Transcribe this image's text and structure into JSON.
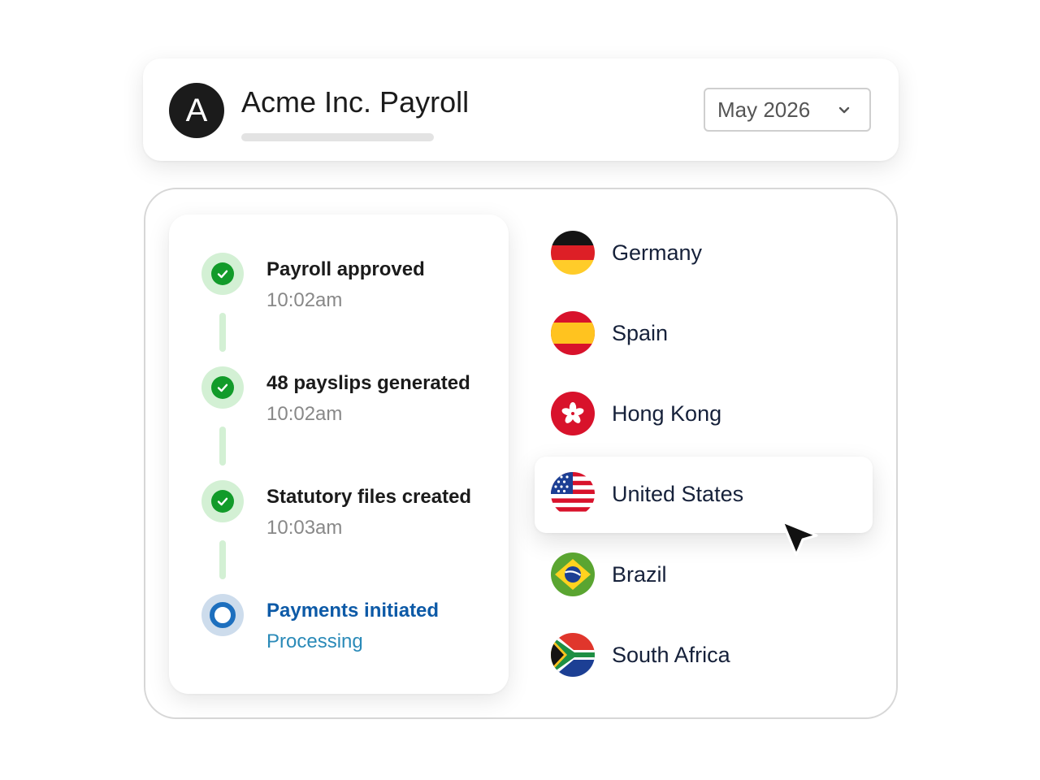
{
  "header": {
    "avatar_letter": "A",
    "title": "Acme Inc. Payroll",
    "month_select": {
      "value": "May 2026"
    }
  },
  "timeline": {
    "steps": [
      {
        "title": "Payroll approved",
        "time": "10:02am",
        "status": "done"
      },
      {
        "title": "48 payslips generated",
        "time": "10:02am",
        "status": "done"
      },
      {
        "title": "Statutory files created",
        "time": "10:03am",
        "status": "done"
      },
      {
        "title": "Payments initiated",
        "time": "Processing",
        "status": "in-progress"
      }
    ]
  },
  "countries": {
    "items": [
      {
        "name": "Germany",
        "flag_icon": "germany-flag-icon"
      },
      {
        "name": "Spain",
        "flag_icon": "spain-flag-icon"
      },
      {
        "name": "Hong Kong",
        "flag_icon": "hong-kong-flag-icon"
      },
      {
        "name": "United States",
        "flag_icon": "united-states-flag-icon",
        "highlighted": true
      },
      {
        "name": "Brazil",
        "flag_icon": "brazil-flag-icon"
      },
      {
        "name": "South Africa",
        "flag_icon": "south-africa-flag-icon"
      }
    ]
  },
  "colors": {
    "done_green": "#129b2a",
    "done_halo": "#d3f0d4",
    "active_blue": "#0d5aa7",
    "processing_blue": "#2a8ab8"
  }
}
